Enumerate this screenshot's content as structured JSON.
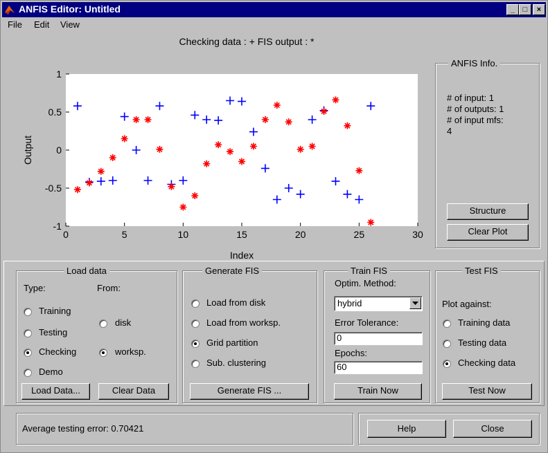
{
  "window": {
    "title": "ANFIS Editor: Untitled",
    "minimize": "_",
    "maximize": "□",
    "close": "×"
  },
  "menu": {
    "file": "File",
    "edit": "Edit",
    "view": "View"
  },
  "chart_data": {
    "type": "scatter",
    "title": "Checking data : +   FIS output : *",
    "xlabel": "Index",
    "ylabel": "Output",
    "xlim": [
      0,
      30
    ],
    "ylim": [
      -1,
      1
    ],
    "xticks": [
      "0",
      "5",
      "10",
      "15",
      "20",
      "25",
      "30"
    ],
    "yticks": [
      "1",
      "0.5",
      "0",
      "-0.5",
      "-1"
    ],
    "series": [
      {
        "marker": "+",
        "color": "#0000ff",
        "x": [
          1,
          2,
          3,
          4,
          5,
          6,
          7,
          8,
          9,
          10,
          11,
          12,
          13,
          14,
          15,
          16,
          17,
          18,
          19,
          20,
          21,
          22,
          23,
          24,
          25,
          26
        ],
        "y": [
          0.58,
          -0.42,
          -0.41,
          -0.4,
          0.44,
          0.0,
          -0.4,
          0.58,
          -0.45,
          -0.4,
          0.46,
          0.4,
          0.39,
          0.65,
          0.64,
          0.24,
          -0.24,
          -0.65,
          -0.5,
          -0.58,
          0.4,
          0.52,
          -0.41,
          -0.58,
          -0.65,
          0.58
        ]
      },
      {
        "marker": "*",
        "color": "#ff0000",
        "x": [
          1,
          2,
          3,
          4,
          5,
          6,
          7,
          8,
          9,
          10,
          11,
          12,
          13,
          14,
          15,
          16,
          17,
          18,
          19,
          20,
          21,
          22,
          23,
          24,
          25,
          26
        ],
        "y": [
          -0.52,
          -0.43,
          -0.28,
          -0.1,
          0.15,
          0.4,
          0.4,
          0.01,
          -0.48,
          -0.75,
          -0.6,
          -0.18,
          0.07,
          -0.02,
          -0.15,
          0.05,
          0.4,
          0.59,
          0.37,
          0.01,
          0.05,
          0.51,
          0.66,
          0.32,
          -0.27,
          -0.95
        ]
      }
    ]
  },
  "info": {
    "title": "ANFIS Info.",
    "line1": "# of input: 1",
    "line2": "# of outputs: 1",
    "line3": "# of input mfs:",
    "line4": "4",
    "structure_btn": "Structure",
    "clear_plot_btn": "Clear Plot"
  },
  "load": {
    "title": "Load data",
    "type_label": "Type:",
    "from_label": "From:",
    "training": "Training",
    "testing": "Testing",
    "checking": "Checking",
    "demo": "Demo",
    "disk": "disk",
    "worksp": "worksp.",
    "load_btn": "Load Data...",
    "clear_btn": "Clear Data"
  },
  "gen": {
    "title": "Generate FIS",
    "opt1": "Load from disk",
    "opt2": "Load from worksp.",
    "opt3": "Grid partition",
    "opt4": "Sub. clustering",
    "btn": "Generate FIS ..."
  },
  "train": {
    "title": "Train FIS",
    "method_label": "Optim. Method:",
    "method_value": "hybrid",
    "tol_label": "Error Tolerance:",
    "tol_value": "0",
    "epochs_label": "Epochs:",
    "epochs_value": "60",
    "btn": "Train Now"
  },
  "test": {
    "title": "Test FIS",
    "plot_label": "Plot against:",
    "opt1": "Training data",
    "opt2": "Testing data",
    "opt3": "Checking data",
    "btn": "Test Now"
  },
  "status": {
    "text": "Average testing error: 0.70421"
  },
  "footer": {
    "help": "Help",
    "close": "Close"
  }
}
